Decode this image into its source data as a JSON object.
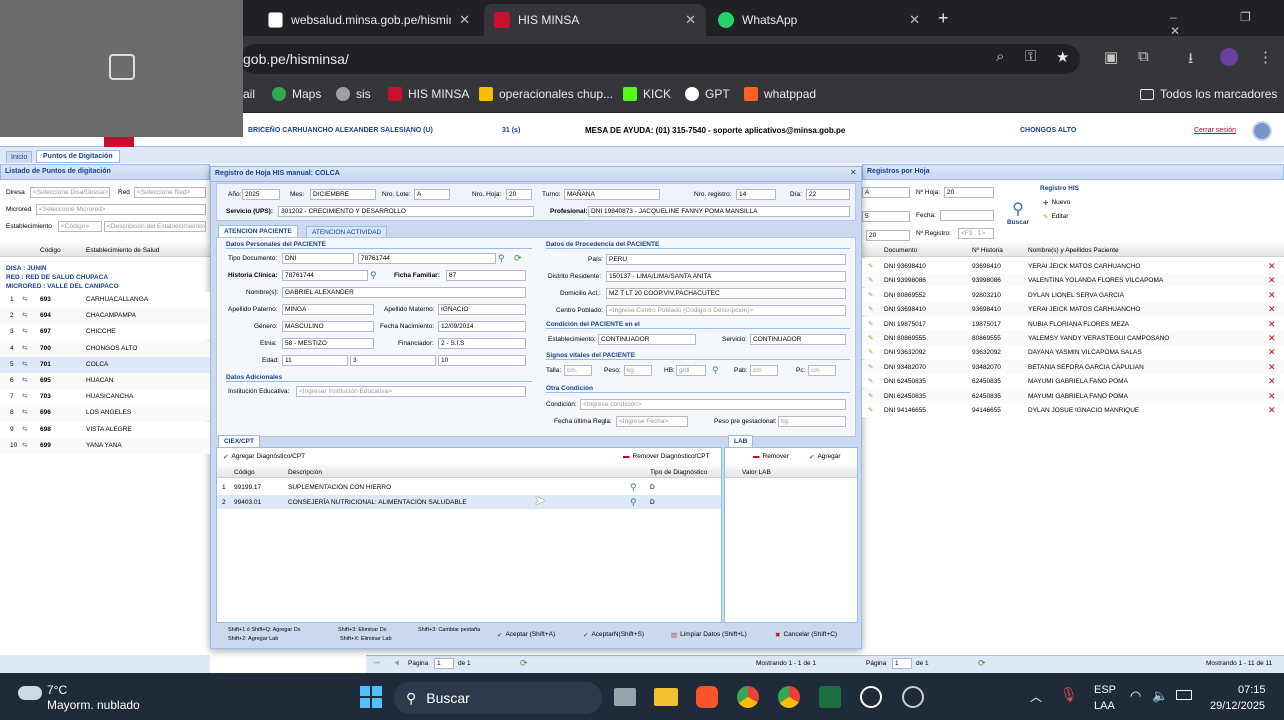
{
  "browser": {
    "tabs": [
      {
        "label": "websalud.minsa.gob.pe/hisminsa"
      },
      {
        "label": "HIS MINSA"
      },
      {
        "label": "WhatsApp"
      }
    ],
    "new_tab": "+",
    "url": "gob.pe/hisminsa/",
    "bookmarks": [
      "ail",
      "Maps",
      "sis",
      "HIS MINSA",
      "operacionales chup...",
      "KICK",
      "GPT",
      "whatppad"
    ],
    "all_bookmarks": "Todos los marcadores"
  },
  "app": {
    "user": "BRICEÑO CARHUANCHO ALEXANDER SALESIANO (U)",
    "count": "31 (s)",
    "help": "MESA DE AYUDA: (01) 315-7540 - soporte  aplicativos@minsa.gob.pe",
    "location": "CHONGOS ALTO",
    "logout": "Cerrar sesión",
    "tabs": [
      "Inicio",
      "Puntos de Digitación"
    ],
    "left": {
      "title": "Listado de Puntos de digitación",
      "diresa_lbl": "Diresa",
      "diresa_ph": "<Seleccione Disa/Diresa>",
      "red_lbl": "Red",
      "red_ph": "<Seleccione Red>",
      "micro_lbl": "Microred",
      "micro_ph": "<Seleccione Microred>",
      "estab_lbl": "Establecimiento",
      "cod_ph": "<Código>",
      "desc_ph": "<Descripción del Establecimiento>",
      "col_codigo": "Código",
      "col_estab": "Establecimiento de Salud",
      "disa": "DISA : JUNIN",
      "red": "RED : RED DE SALUD CHUPACA",
      "microred": "MICRORED : VALLE DEL CANIPACO",
      "rows": [
        [
          "1",
          "693",
          "CARHUACALLANGA"
        ],
        [
          "2",
          "694",
          "CHACAMPAMPA"
        ],
        [
          "3",
          "697",
          "CHICCHE"
        ],
        [
          "4",
          "700",
          "CHONGOS ALTO"
        ],
        [
          "5",
          "701",
          "COLCA"
        ],
        [
          "6",
          "695",
          "HUACAN"
        ],
        [
          "7",
          "703",
          "HUASICANCHA"
        ],
        [
          "8",
          "696",
          "LOS ANGELES"
        ],
        [
          "9",
          "698",
          "VISTA ALEGRE"
        ],
        [
          "10",
          "699",
          "YANA YANA"
        ]
      ]
    },
    "right": {
      "title": "Registros por Hoja",
      "hoja_lbl": "Nº Hoja:",
      "hoja_val": "20",
      "fecha_lbl": "Fecha:",
      "reg_lbl": "Nº Registro:",
      "reg_ph": "<F3 : 1>",
      "buscar": "Buscar",
      "reg_his": "Registro HIS",
      "nuevo": "Nuevo",
      "editar": "Editar",
      "v1": "A",
      "v2": "5",
      "v3": "20",
      "cols": [
        "Documento",
        "Nº Historia",
        "Nombre(s) y Apellidos Paciente"
      ],
      "rows": [
        [
          "DNI 93698410",
          "93698410",
          "YERAI JEICK MATOS CARHUANCHO"
        ],
        [
          "DNI 93998086",
          "93998086",
          "VALENTINA YOLANDA FLORES VILCAPOMA"
        ],
        [
          "DNI 80869552",
          "92803210",
          "DYLAN LIONEL SERVA GARCIA"
        ],
        [
          "DNI 93698410",
          "93698410",
          "YERAI JEICK MATOS CARHUANCHO"
        ],
        [
          "DNI 19875017",
          "19875017",
          "NUBIA FLORIANA FLORES MEZA"
        ],
        [
          "DNI 80869555",
          "80869555",
          "YALEMSY YANDY VERASTEGUI CAMPOSANO"
        ],
        [
          "DNI 93632092",
          "93632092",
          "DAYANA YASMIN VILCAPOMA SALAS"
        ],
        [
          "DNI 93482070",
          "93482070",
          "BETANIA SEFORA GARCIA CAPULIAN"
        ],
        [
          "DNI 62450835",
          "62450835",
          "MAYUMI GABRIELA FANO POMA"
        ],
        [
          "DNI 62450835",
          "62450835",
          "MAYUMI GABRIELA FANO POMA"
        ],
        [
          "DNI 94146655",
          "94146655",
          "DYLAN JOSUE IGNACIO MANRIQUE"
        ]
      ]
    },
    "modal": {
      "title": "Registro de Hoja HIS manual: COLCA",
      "anio_lbl": "Año:",
      "anio": "2025",
      "mes_lbl": "Mes:",
      "mes": "DICIEMBRE",
      "lote_lbl": "Nro. Lote:",
      "lote": "A",
      "hoja_lbl": "Nro. Hoja:",
      "hoja": "20",
      "turno_lbl": "Turno:",
      "turno": "MAÑANA",
      "reg_lbl": "Nro. registro:",
      "reg": "14",
      "dia_lbl": "Día:",
      "dia": "22",
      "ups_lbl": "Servicio (UPS):",
      "ups": "301202 - CRECIMIENTO Y DESARROLLO",
      "prof_lbl": "Profesional:",
      "prof": "DNI 19840873 - JACQUELINE FANNY POMA MANSILLA",
      "tab1": "ATENCION PACIENTE",
      "tab2": "ATENCION ACTIVIDAD",
      "pac_title": "Datos Personales del PACIENTE",
      "tipo_lbl": "Tipo Documento:",
      "tipo": "DNI",
      "doc": "78761744",
      "hc_lbl": "Historia Clínica:",
      "hc": "78761744",
      "ficha_lbl": "Ficha Familiar:",
      "ficha": "87",
      "nom_lbl": "Nombre(s):",
      "nom": "GABRIEL ALEXANDER",
      "ap_lbl": "Apellido Paterno:",
      "ap": "MINGA",
      "am_lbl": "Apellido Materno:",
      "am": "IGNACIO",
      "gen_lbl": "Género:",
      "gen": "MASCULINO",
      "fn_lbl": "Fecha Nacimiento:",
      "fn": "12/09/2014",
      "etnia_lbl": "Etnia:",
      "etnia": "58 - MESTIZO",
      "fin_lbl": "Financiador:",
      "fin": "2 - S.I.S",
      "edad_lbl": "Edad:",
      "e1": "11",
      "e2": "3",
      "e3": "10",
      "adic_title": "Datos Adicionales",
      "ie_lbl": "Institución Educativa:",
      "ie_ph": "<Ingresar Institución Educativa>",
      "proc_title": "Datos de Procedencia del PACIENTE",
      "pais_lbl": "País:",
      "pais": "PERU",
      "dist_lbl": "Distrito Residente:",
      "dist": "150137 - LIMA/LIMA/SANTA ANITA",
      "dom_lbl": "Domicilio Act.:",
      "dom": "MZ T LT 20 COOP.VIV.PACHACUTEC",
      "cp_lbl": "Centro Poblado:",
      "cp_ph": "<Ingrese Centro Poblado (Código o Descripción)>",
      "cond_title": "Condición del PACIENTE en el",
      "est_lbl": "Establecimiento:",
      "est": "CONTINUADOR",
      "serv_lbl": "Servicio:",
      "serv": "CONTINUADOR",
      "sv_title": "Signos vitales del PACIENTE",
      "talla": "Talla:",
      "talla_u": "cm.",
      "peso": "Peso:",
      "peso_u": "kg.",
      "hb": "HB:",
      "hb_u": "g/dl",
      "pab": "Pab:",
      "pab_u": "cm",
      "pc": "Pc:",
      "pc_u": "cm",
      "otra_title": "Otra Condición",
      "condicion_lbl": "Condición:",
      "condicion_ph": "<Ingrese condición>",
      "fur_lbl": "Fecha última Regla:",
      "fur_ph": "<Ingrese Fecha>",
      "pg_lbl": "Peso pre gestacional:",
      "pg_u": "kg.",
      "cie_tab": "CIEX/CPT",
      "add_dx": "Agregar Diagnóstico/CPT",
      "rem_dx": "Remover Diagnóstico/CPT",
      "col_cod": "Código",
      "col_desc": "Descripción",
      "col_tipo": "Tipo de Diagnóstico",
      "dx": [
        [
          "1",
          "99199.17",
          "SUPLEMENTACIÓN CON HIERRO",
          "D"
        ],
        [
          "2",
          "99403.01",
          "CONSEJERÍA NUTRICIONAL: ALIMENTACIÓN SALUDABLE",
          "D"
        ]
      ],
      "lab_tab": "LAB",
      "lab_rem": "Remover",
      "lab_add": "Agregar",
      "lab_col": "Valor LAB",
      "sc1": "Shift+1 ó Shift+Q: Agregar Dx",
      "sc2": "Shift+2: Agregar Lab",
      "sc3": "Shift+3: Eliminar Dx",
      "sc4": "Shift+X: Eliminar Lab",
      "sc5": "Shift+3: Cambiar pestaña",
      "aceptar": "Aceptar (Shift+A)",
      "aceptarn": "AceptarN(Shift+S)",
      "limpiar": "Limpiar Datos (Shift+L)",
      "cancelar": "Cancelar (Shift+C)"
    },
    "pager_l": {
      "pagina": "Página",
      "val": "1",
      "de": "de 1",
      "info": "Mostrando 1 - 1 de 1"
    },
    "pager_r": {
      "pagina": "Página",
      "val": "1",
      "de": "de 1",
      "info": "Mostrando 1 - 11 de 11"
    }
  },
  "taskbar": {
    "temp": "7°C",
    "weather": "Mayorm. nublado",
    "search": "Buscar",
    "lang1": "ESP",
    "lang2": "LAA",
    "time": "07:15",
    "date": "29/12/2025"
  }
}
